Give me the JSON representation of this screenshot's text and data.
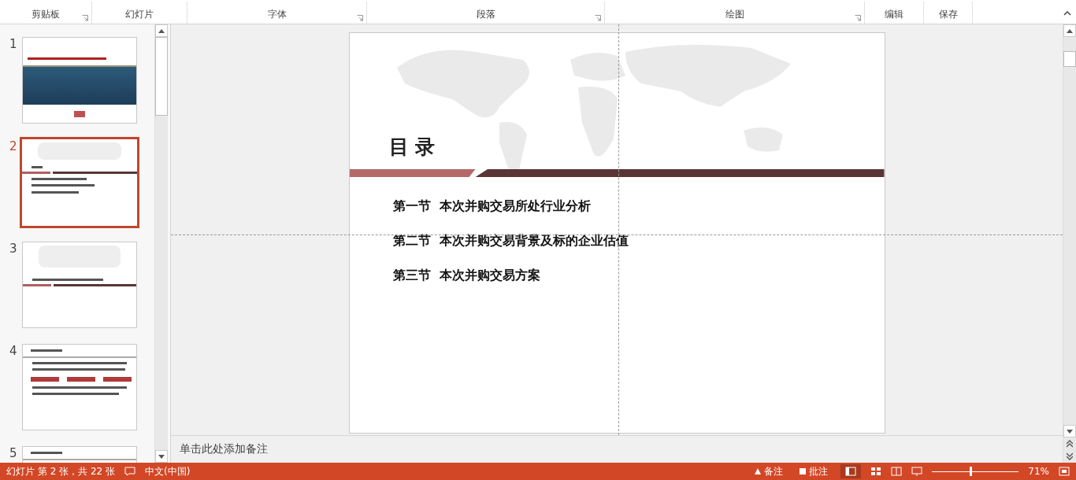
{
  "ribbon": {
    "groups": [
      {
        "label": "剪贴板",
        "launcher": true
      },
      {
        "label": "幻灯片",
        "launcher": false
      },
      {
        "label": "字体",
        "launcher": true
      },
      {
        "label": "段落",
        "launcher": true
      },
      {
        "label": "绘图",
        "launcher": true
      },
      {
        "label": "编辑",
        "launcher": false
      },
      {
        "label": "保存",
        "launcher": false
      }
    ]
  },
  "thumbnails": [
    {
      "number": "1",
      "kind": "cover",
      "selected": false
    },
    {
      "number": "2",
      "kind": "contents",
      "selected": true
    },
    {
      "number": "3",
      "kind": "section",
      "selected": false
    },
    {
      "number": "4",
      "kind": "content",
      "selected": false
    },
    {
      "number": "5",
      "kind": "content",
      "selected": false
    }
  ],
  "slide": {
    "title": "目 录",
    "items": [
      "第一节  本次并购交易所处行业分析",
      "第二节  本次并购交易背景及标的企业估值",
      "第三节  本次并购交易方案"
    ]
  },
  "notes": {
    "placeholder": "单击此处添加备注"
  },
  "status_bar": {
    "slide_info": "幻灯片 第 2 张，共 22 张",
    "language": "中文(中国)",
    "notes_button": "备注",
    "comments_button": "批注",
    "zoom": "71%",
    "zoom_slider": {
      "level": 0.45
    }
  }
}
